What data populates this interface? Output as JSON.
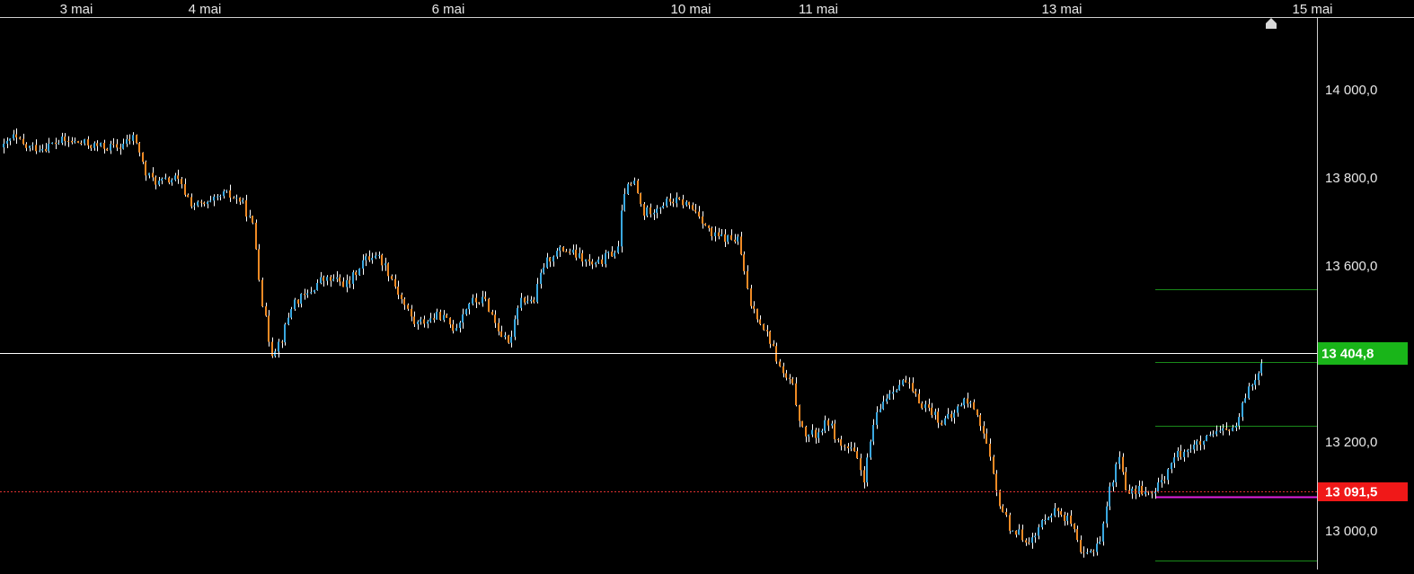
{
  "colors": {
    "background": "#000000",
    "up": "#3aa8e0",
    "down": "#f08a24",
    "wick": "#ffffff",
    "axis": "#cfcfcf",
    "current_price_line": "#ffffff",
    "current_price_badge": "#19b519",
    "ref_price_line": "#e03030",
    "ref_price_badge": "#f01818",
    "level_line": "#1a8a1a",
    "magenta_line": "#e020e0"
  },
  "icons": {
    "scroll_marker": "home-icon"
  },
  "chart_data": {
    "type": "candlestick",
    "title": "",
    "x_dates": [
      "3 mai",
      "4 mai",
      "6 mai",
      "10 mai",
      "11 mai",
      "13 mai",
      "15 mai"
    ],
    "y_ticks": [
      "14 000,0",
      "13 800,0",
      "13 600,0",
      "13 200,0",
      "13 000,0"
    ],
    "y_tick_values": [
      14000,
      13800,
      13600,
      13200,
      13000
    ],
    "y_range": [
      12915,
      14163
    ],
    "grid": false,
    "current_price": {
      "value": 13404.8,
      "label": "13 404,8"
    },
    "reference_price": {
      "value": 13091.5,
      "label": "13 091,5"
    },
    "levels": [
      13550,
      13385,
      13240,
      12935
    ],
    "magenta_level": 13080,
    "anchors": [
      [
        0,
        13860
      ],
      [
        14,
        13895
      ],
      [
        28,
        13870
      ],
      [
        48,
        13870
      ],
      [
        68,
        13885
      ],
      [
        90,
        13880
      ],
      [
        110,
        13872
      ],
      [
        132,
        13870
      ],
      [
        150,
        13895
      ],
      [
        162,
        13810
      ],
      [
        176,
        13790
      ],
      [
        196,
        13800
      ],
      [
        214,
        13740
      ],
      [
        232,
        13740
      ],
      [
        250,
        13765
      ],
      [
        268,
        13750
      ],
      [
        282,
        13690
      ],
      [
        292,
        13520
      ],
      [
        302,
        13405
      ],
      [
        314,
        13440
      ],
      [
        326,
        13520
      ],
      [
        342,
        13535
      ],
      [
        356,
        13570
      ],
      [
        372,
        13570
      ],
      [
        388,
        13560
      ],
      [
        402,
        13610
      ],
      [
        418,
        13630
      ],
      [
        430,
        13600
      ],
      [
        446,
        13530
      ],
      [
        462,
        13470
      ],
      [
        476,
        13480
      ],
      [
        490,
        13490
      ],
      [
        506,
        13460
      ],
      [
        522,
        13520
      ],
      [
        540,
        13525
      ],
      [
        552,
        13470
      ],
      [
        566,
        13420
      ],
      [
        578,
        13530
      ],
      [
        594,
        13520
      ],
      [
        604,
        13600
      ],
      [
        616,
        13630
      ],
      [
        628,
        13640
      ],
      [
        646,
        13620
      ],
      [
        662,
        13600
      ],
      [
        676,
        13625
      ],
      [
        688,
        13640
      ],
      [
        694,
        13770
      ],
      [
        706,
        13790
      ],
      [
        716,
        13720
      ],
      [
        730,
        13735
      ],
      [
        746,
        13750
      ],
      [
        762,
        13745
      ],
      [
        778,
        13720
      ],
      [
        792,
        13670
      ],
      [
        806,
        13665
      ],
      [
        822,
        13660
      ],
      [
        834,
        13520
      ],
      [
        846,
        13480
      ],
      [
        858,
        13430
      ],
      [
        870,
        13360
      ],
      [
        882,
        13330
      ],
      [
        894,
        13220
      ],
      [
        908,
        13220
      ],
      [
        922,
        13250
      ],
      [
        934,
        13200
      ],
      [
        950,
        13180
      ],
      [
        962,
        13120
      ],
      [
        972,
        13240
      ],
      [
        984,
        13300
      ],
      [
        996,
        13330
      ],
      [
        1008,
        13340
      ],
      [
        1020,
        13300
      ],
      [
        1034,
        13280
      ],
      [
        1048,
        13250
      ],
      [
        1060,
        13260
      ],
      [
        1072,
        13300
      ],
      [
        1086,
        13280
      ],
      [
        1098,
        13200
      ],
      [
        1110,
        13080
      ],
      [
        1124,
        13010
      ],
      [
        1138,
        12990
      ],
      [
        1150,
        12980
      ],
      [
        1164,
        13040
      ],
      [
        1178,
        13050
      ],
      [
        1192,
        13020
      ],
      [
        1204,
        12940
      ],
      [
        1214,
        12955
      ],
      [
        1226,
        12990
      ],
      [
        1234,
        13090
      ],
      [
        1246,
        13170
      ],
      [
        1256,
        13080
      ],
      [
        1268,
        13100
      ],
      [
        1282,
        13080
      ],
      [
        1294,
        13120
      ],
      [
        1308,
        13170
      ],
      [
        1322,
        13190
      ],
      [
        1338,
        13200
      ],
      [
        1352,
        13220
      ],
      [
        1366,
        13230
      ],
      [
        1378,
        13240
      ],
      [
        1386,
        13310
      ],
      [
        1398,
        13350
      ],
      [
        1407,
        13410
      ]
    ]
  }
}
